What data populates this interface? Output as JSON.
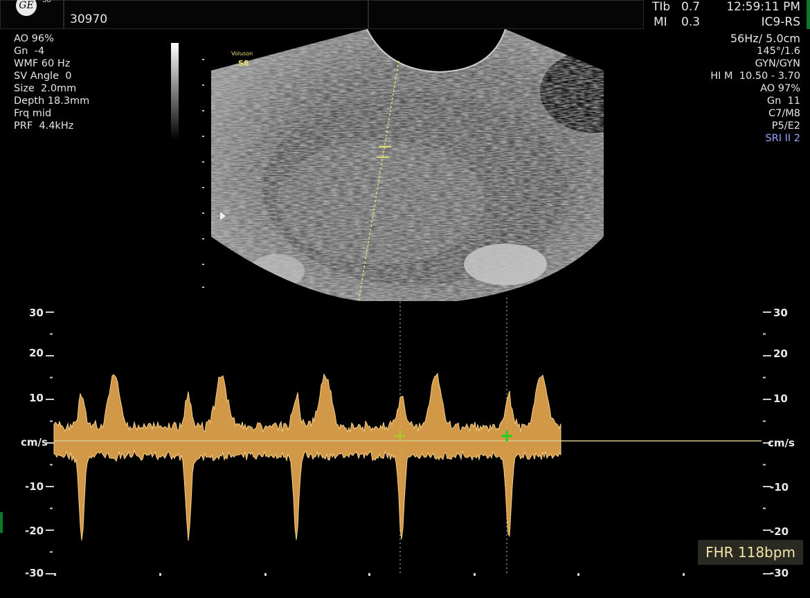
{
  "header": {
    "patient_partial": "30970",
    "probe": "S8",
    "tib_label": "TIb",
    "tib_value": "0.7",
    "mi_label": "MI",
    "mi_value": "0.3",
    "time": "12:59:11 PM",
    "probe_name": "IC9-RS"
  },
  "left_params": [
    "AO 96%",
    "Gn  -4",
    "WMF 60 Hz",
    "SV Angle  0",
    "Size  2.0mm",
    "Depth 18.3mm",
    "Frq mid",
    "PRF  4.4kHz"
  ],
  "right_params": [
    "56Hz/ 5.0cm",
    "145°/1.6",
    "GYN/GYN",
    "HI M  10.50 - 3.70",
    "AO 97%",
    "Gn  11",
    "C7/M8",
    "P5/E2"
  ],
  "right_highlight": "SRI II 2",
  "image_label": {
    "line1": "Voluson",
    "line2": "S8"
  },
  "velocity_scale": {
    "labels": [
      "30",
      "20",
      "10",
      "cm/s",
      "-10",
      "-20",
      "-30"
    ]
  },
  "fhr": "FHR 118bpm",
  "colors": {
    "spectrum": "#e8a850",
    "baseline": "#d8c890",
    "caliper": "#1fd21f",
    "highlight": "#9aa6ff",
    "gate": "#e8e070"
  }
}
